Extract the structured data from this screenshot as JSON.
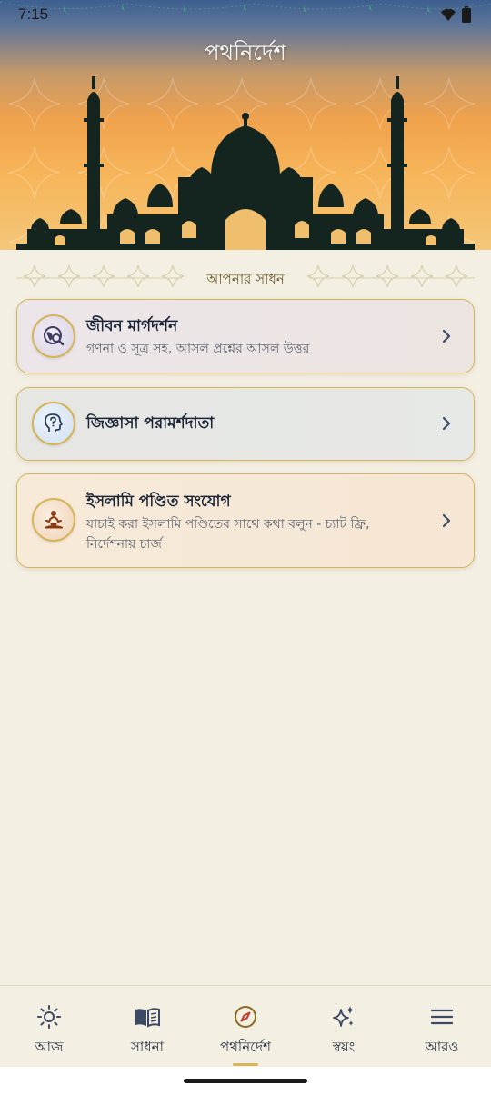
{
  "status_bar": {
    "time": "7:15"
  },
  "header": {
    "title": "পথনির্দেশ"
  },
  "section": {
    "label": "আপনার সাধন"
  },
  "cards": [
    {
      "title": "জীবন মার্গদর্শন",
      "subtitle": "গণনা ও সূত্র সহ, আসল প্রশ্নের আসল উত্তর",
      "icon": "globe-search-icon"
    },
    {
      "title": "জিজ্ঞাসা পরামর্শদাতা",
      "subtitle": "",
      "icon": "head-question-icon"
    },
    {
      "title": "ইসলামি পণ্ডিত সংযোগ",
      "subtitle_line1": "যাচাই করা ইসলামি পণ্ডিতের সাথে কথা বলুন - চ্যাট ফ্রি,",
      "subtitle_line2": "নির্দেশনায় চার্জ",
      "icon": "meditation-icon"
    }
  ],
  "bottom_nav": {
    "items": [
      {
        "label": "আজ",
        "icon": "sun-icon"
      },
      {
        "label": "সাধনা",
        "icon": "book-icon"
      },
      {
        "label": "পথনির্দেশ",
        "icon": "compass-icon",
        "active": true
      },
      {
        "label": "স্বয়ং",
        "icon": "sparkles-icon"
      },
      {
        "label": "আরও",
        "icon": "menu-icon"
      }
    ]
  },
  "colors": {
    "accent_gold": "#d6b45a",
    "background": "#f3efe3",
    "text": "#1f2a3d"
  }
}
